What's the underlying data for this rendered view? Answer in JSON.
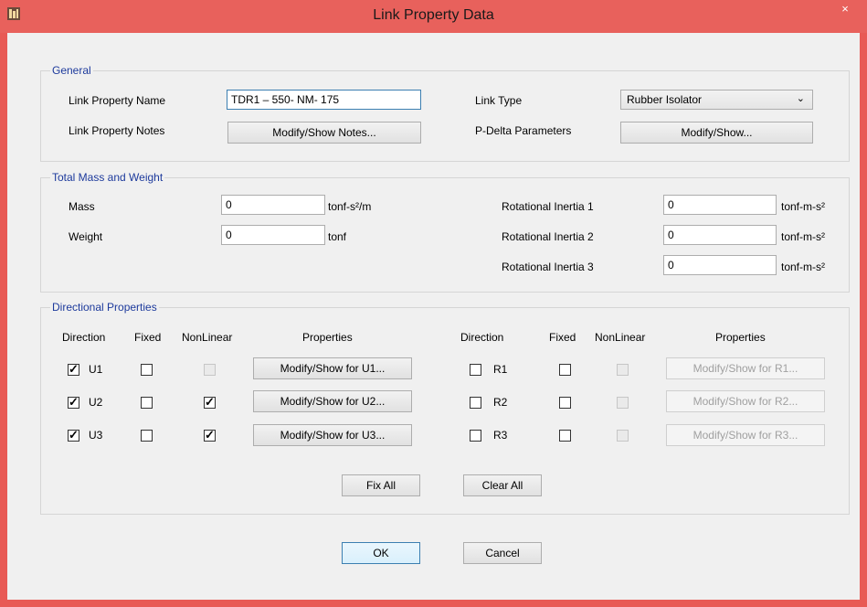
{
  "window": {
    "title": "Link Property Data",
    "close_glyph": "×"
  },
  "general": {
    "title": "General",
    "name_label": "Link Property Name",
    "name_value": "TDR1 – 550- NM- 175",
    "notes_label": "Link Property Notes",
    "notes_button": "Modify/Show Notes...",
    "type_label": "Link Type",
    "type_value": "Rubber Isolator",
    "pdelta_label": "P-Delta Parameters",
    "pdelta_button": "Modify/Show..."
  },
  "mass": {
    "title": "Total Mass and Weight",
    "mass_label": "Mass",
    "mass_value": "0",
    "mass_unit": "tonf-s²/m",
    "weight_label": "Weight",
    "weight_value": "0",
    "weight_unit": "tonf",
    "ri1_label": "Rotational Inertia 1",
    "ri1_value": "0",
    "ri1_unit": "tonf-m-s²",
    "ri2_label": "Rotational Inertia 2",
    "ri2_value": "0",
    "ri2_unit": "tonf-m-s²",
    "ri3_label": "Rotational Inertia 3",
    "ri3_value": "0",
    "ri3_unit": "tonf-m-s²"
  },
  "directional": {
    "title": "Directional Properties",
    "headers": {
      "direction": "Direction",
      "fixed": "Fixed",
      "nonlinear": "NonLinear",
      "properties": "Properties"
    },
    "left": [
      {
        "dir": "U1",
        "checked": true,
        "fixed": false,
        "nonlinear": false,
        "nonlinear_disabled": true,
        "button": "Modify/Show for U1..."
      },
      {
        "dir": "U2",
        "checked": true,
        "fixed": false,
        "nonlinear": true,
        "nonlinear_disabled": false,
        "button": "Modify/Show for U2..."
      },
      {
        "dir": "U3",
        "checked": true,
        "fixed": false,
        "nonlinear": true,
        "nonlinear_disabled": false,
        "button": "Modify/Show for U3..."
      }
    ],
    "right": [
      {
        "dir": "R1",
        "checked": false,
        "fixed": false,
        "button": "Modify/Show for R1..."
      },
      {
        "dir": "R2",
        "checked": false,
        "fixed": false,
        "button": "Modify/Show for R2..."
      },
      {
        "dir": "R3",
        "checked": false,
        "fixed": false,
        "button": "Modify/Show for R3..."
      }
    ],
    "fix_all": "Fix All",
    "clear_all": "Clear All"
  },
  "footer": {
    "ok": "OK",
    "cancel": "Cancel"
  }
}
